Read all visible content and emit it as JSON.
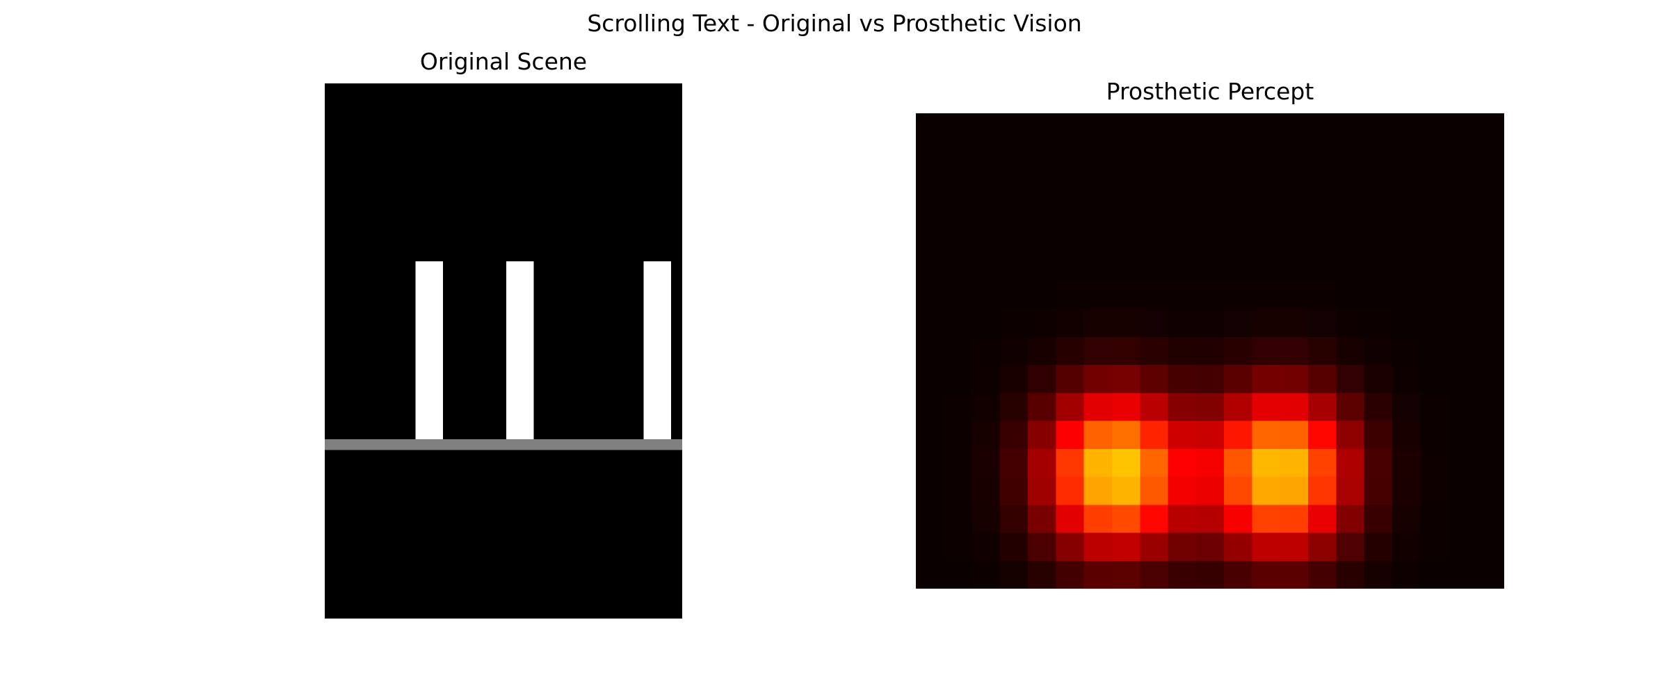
{
  "figure": {
    "title": "Scrolling Text - Original vs Prosthetic Vision"
  },
  "chart_data": [
    {
      "type": "heatmap",
      "title": "Original Scene",
      "colormap": "gray",
      "value_range": [
        0,
        1
      ],
      "axes": "off",
      "rows": 20,
      "cols": 13,
      "background": 0,
      "rects": [
        {
          "label": "bar-1",
          "row_start": 6.65,
          "row_end": 13.3,
          "col_start": 3.3,
          "col_end": 4.3,
          "value": 1
        },
        {
          "label": "bar-2",
          "row_start": 6.65,
          "row_end": 13.3,
          "col_start": 6.6,
          "col_end": 7.6,
          "value": 1
        },
        {
          "label": "bar-3",
          "row_start": 6.65,
          "row_end": 13.3,
          "col_start": 11.6,
          "col_end": 12.6,
          "value": 1
        },
        {
          "label": "baseline",
          "row_start": 13.3,
          "row_end": 13.7,
          "col_start": 0,
          "col_end": 13,
          "value": 0.5
        }
      ]
    },
    {
      "type": "heatmap",
      "title": "Prosthetic Percept",
      "colormap": "hot",
      "value_range": [
        0,
        1
      ],
      "axes": "off",
      "rows": 17,
      "cols": 21,
      "model": {
        "background": 0.015,
        "center_row": 12.35,
        "spread_row": 2.8,
        "spread_col": 2.5,
        "sources": [
          {
            "col": 6.6,
            "amplitude": 0.66
          },
          {
            "col": 12.5,
            "amplitude": 0.65
          }
        ]
      }
    }
  ]
}
